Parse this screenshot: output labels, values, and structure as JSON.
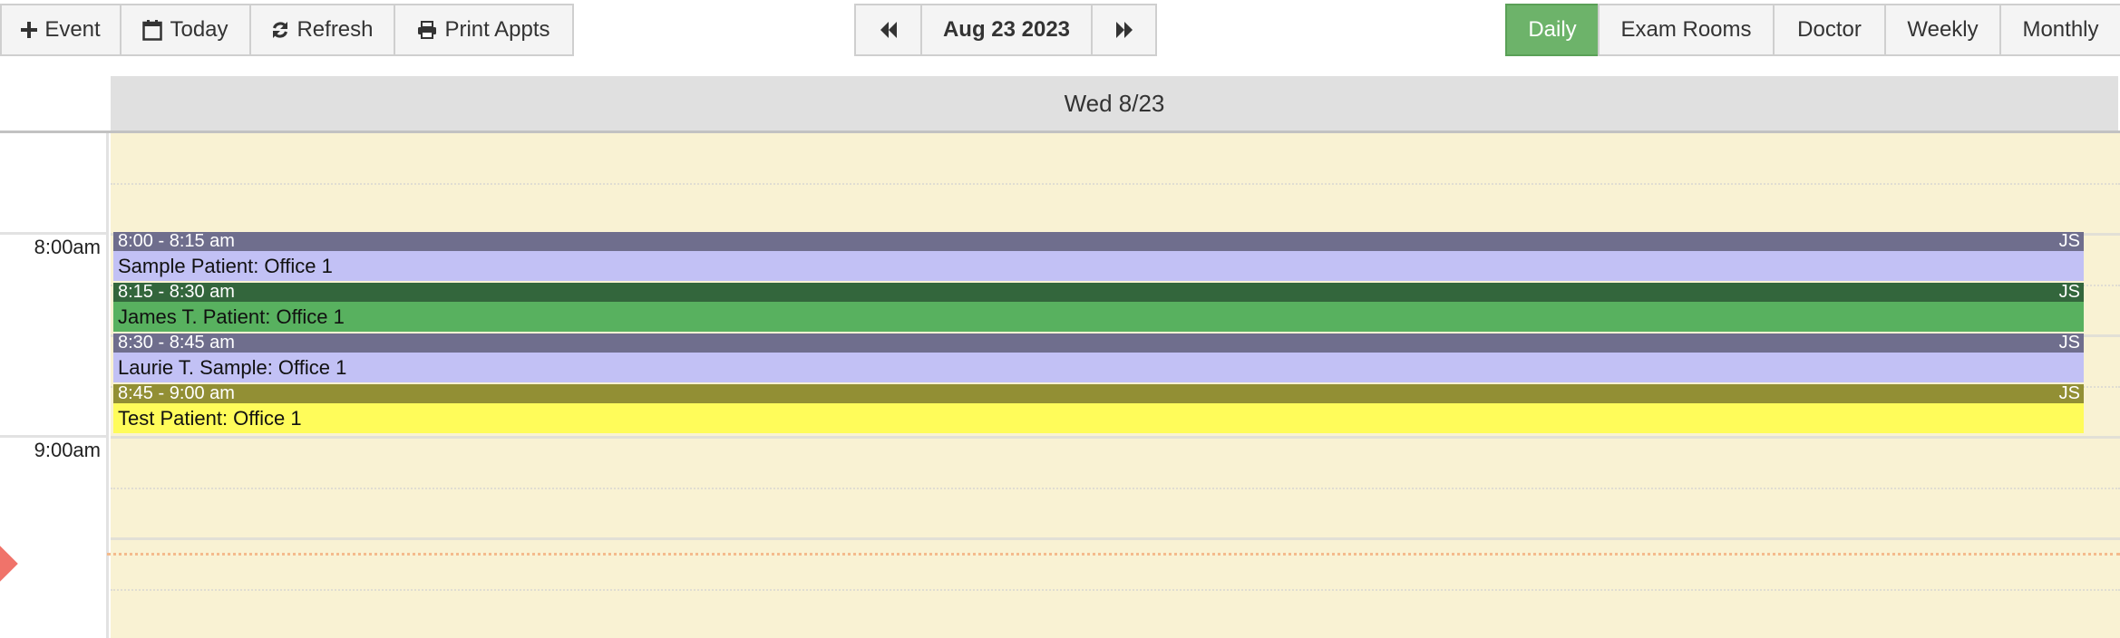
{
  "toolbar": {
    "left": [
      {
        "label": "Event",
        "icon": "plus-icon"
      },
      {
        "label": "Today",
        "icon": "calendar-icon"
      },
      {
        "label": "Refresh",
        "icon": "refresh-icon"
      },
      {
        "label": "Print Appts",
        "icon": "print-icon"
      }
    ],
    "nav": {
      "prev_icon": "fast-backward-icon",
      "date_label": "Aug 23 2023",
      "next_icon": "fast-forward-icon"
    },
    "views": [
      {
        "label": "Daily",
        "active": true
      },
      {
        "label": "Exam Rooms",
        "active": false
      },
      {
        "label": "Doctor",
        "active": false
      },
      {
        "label": "Weekly",
        "active": false
      },
      {
        "label": "Monthly",
        "active": false
      }
    ],
    "active_color": "#6db36a"
  },
  "calendar": {
    "day_header": "Wed 8/23",
    "time_labels": [
      "8:00am",
      "9:00am"
    ],
    "grid_background": "#f9f2d3",
    "now_indicator_color": "#f0736a",
    "events": [
      {
        "time": "8:00 - 8:15 am",
        "title": "Sample Patient: Office 1",
        "initials": "JS",
        "head_color": "#6f6e8d",
        "body_color": "#c2c1f5"
      },
      {
        "time": "8:15 - 8:30 am",
        "title": "James T. Patient: Office 1",
        "initials": "JS",
        "head_color": "#33663c",
        "body_color": "#58b15f"
      },
      {
        "time": "8:30 - 8:45 am",
        "title": "Laurie T. Sample: Office 1",
        "initials": "JS",
        "head_color": "#6f6e8d",
        "body_color": "#c2c1f5"
      },
      {
        "time": "8:45 - 9:00 am",
        "title": "Test Patient: Office 1",
        "initials": "JS",
        "head_color": "#928f34",
        "body_color": "#fffc5a"
      }
    ]
  }
}
